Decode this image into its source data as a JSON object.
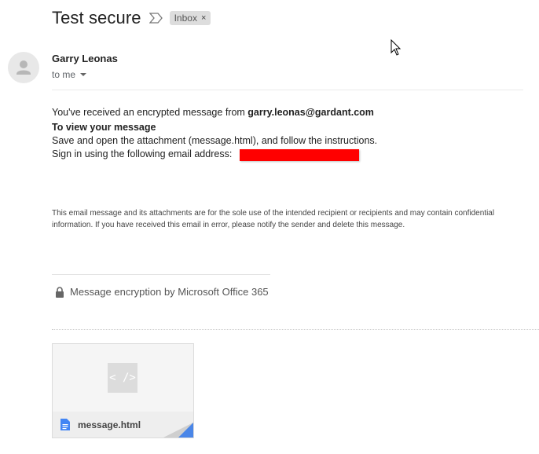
{
  "email": {
    "subject": "Test secure",
    "label": "Inbox",
    "label_close": "×",
    "sender_name": "Garry Leonas",
    "recipient": "to me",
    "intro": "You've received an encrypted message from ",
    "sender_email": "garry.leonas@gardant.com",
    "view_heading": "To view your message",
    "instruction": "Save and open the attachment (message.html), and follow the instructions.",
    "sign_in": "Sign in using the following email address:",
    "disclaimer": "This email message and its attachments are for the sole use of the intended recipient or recipients and may contain confidential information. If you have received this email in error, please notify the sender and delete this message.",
    "encryption_note": "Message encryption by Microsoft Office 365"
  },
  "attachment": {
    "filename": "message.html",
    "preview_glyph": "< />",
    "icon": "doc-icon"
  },
  "icons": {
    "important": "important-marker-icon",
    "avatar": "person-icon",
    "lock": "lock-icon",
    "cursor": "mouse-cursor-icon"
  },
  "colors": {
    "redaction": "#ff0000",
    "doc_icon": "#4285f4",
    "attachment_fold": "#4a86e8"
  }
}
